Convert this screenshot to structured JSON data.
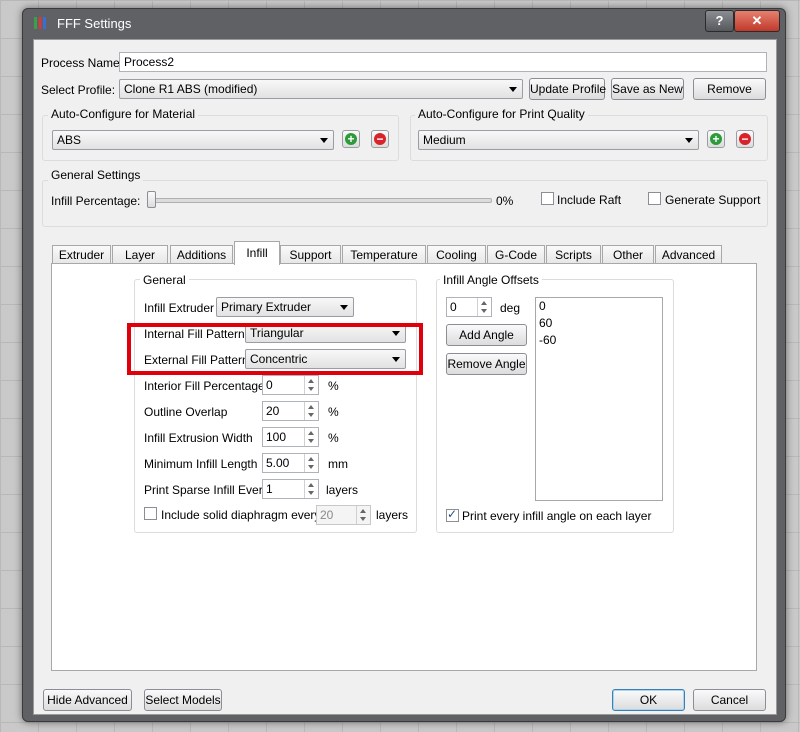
{
  "window": {
    "title": "FFF Settings",
    "help_glyph": "?",
    "close_glyph": "✕"
  },
  "process": {
    "name_label": "Process Name:",
    "name_value": "Process2",
    "profile_label": "Select Profile:",
    "profile_value": "Clone R1 ABS (modified)",
    "update_button": "Update Profile",
    "save_as_new_button": "Save as New",
    "remove_button": "Remove"
  },
  "material": {
    "title": "Auto-Configure for Material",
    "value": "ABS"
  },
  "quality": {
    "title": "Auto-Configure for Print Quality",
    "value": "Medium"
  },
  "general_settings": {
    "title": "General Settings",
    "infill_label": "Infill Percentage:",
    "infill_value": "0%",
    "infill_fraction": 0,
    "include_raft": "Include Raft",
    "include_raft_checked": false,
    "generate_support": "Generate Support",
    "generate_support_checked": false
  },
  "tabs": [
    {
      "label": "Extruder"
    },
    {
      "label": "Layer"
    },
    {
      "label": "Additions"
    },
    {
      "label": "Infill",
      "active": true
    },
    {
      "label": "Support"
    },
    {
      "label": "Temperature"
    },
    {
      "label": "Cooling"
    },
    {
      "label": "G-Code"
    },
    {
      "label": "Scripts"
    },
    {
      "label": "Other"
    },
    {
      "label": "Advanced"
    }
  ],
  "infill_general": {
    "title": "General",
    "extruder_label": "Infill Extruder",
    "extruder_value": "Primary Extruder",
    "internal_label": "Internal Fill Pattern",
    "internal_value": "Triangular",
    "external_label": "External Fill Pattern",
    "external_value": "Concentric",
    "interior_pct_label": "Interior Fill Percentage",
    "interior_pct_value": "0",
    "interior_pct_unit": "%",
    "outline_overlap_label": "Outline Overlap",
    "outline_overlap_value": "20",
    "outline_overlap_unit": "%",
    "extrusion_width_label": "Infill Extrusion Width",
    "extrusion_width_value": "100",
    "extrusion_width_unit": "%",
    "min_length_label": "Minimum Infill Length",
    "min_length_value": "5.00",
    "min_length_unit": "mm",
    "sparse_label": "Print Sparse Infill Every",
    "sparse_value": "1",
    "sparse_unit": "layers",
    "diaphragm_label": "Include solid diaphragm every",
    "diaphragm_checked": false,
    "diaphragm_value": "20",
    "diaphragm_unit": "layers"
  },
  "angle_offsets": {
    "title": "Infill Angle Offsets",
    "angle_value": "0",
    "angle_unit": "deg",
    "add_button": "Add Angle",
    "remove_button": "Remove Angle",
    "angles": [
      "0",
      "60",
      "-60"
    ],
    "print_every_label": "Print every infill angle on each layer",
    "print_every_checked": true
  },
  "footer": {
    "hide_advanced": "Hide Advanced",
    "select_models": "Select Models",
    "ok": "OK",
    "cancel": "Cancel"
  },
  "colors": {
    "highlight": "#e0000a",
    "add": "#2e9b3a",
    "remove": "#d8232a"
  }
}
